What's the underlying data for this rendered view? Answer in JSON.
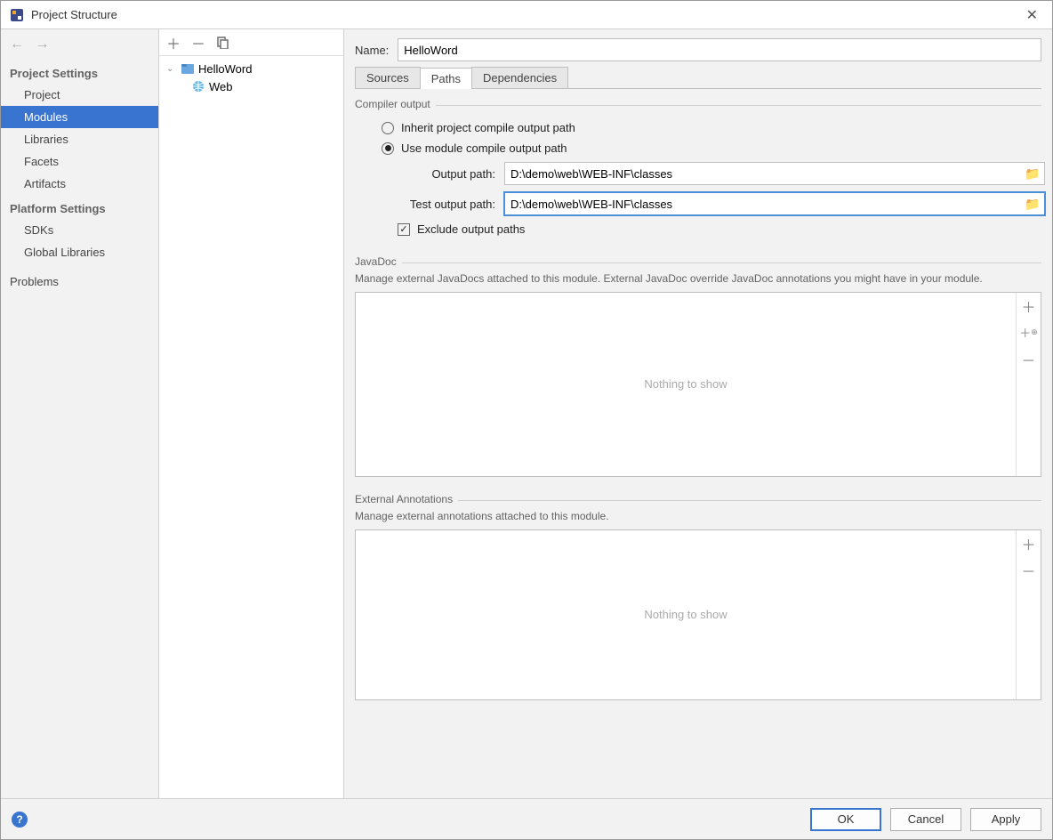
{
  "window": {
    "title": "Project Structure"
  },
  "sidebar": {
    "sections": [
      {
        "title": "Project Settings",
        "items": [
          "Project",
          "Modules",
          "Libraries",
          "Facets",
          "Artifacts"
        ],
        "selected": 1
      },
      {
        "title": "Platform Settings",
        "items": [
          "SDKs",
          "Global Libraries"
        ]
      }
    ],
    "problems": "Problems"
  },
  "tree": {
    "root": {
      "label": "HelloWord"
    },
    "child": {
      "label": "Web"
    }
  },
  "editor": {
    "name_label": "Name:",
    "name_value": "HelloWord",
    "tabs": [
      "Sources",
      "Paths",
      "Dependencies"
    ],
    "active_tab": 1,
    "compiler": {
      "legend": "Compiler output",
      "inherit": "Inherit project compile output path",
      "usemodule": "Use module compile output path",
      "output_label": "Output path:",
      "output_value": "D:\\demo\\web\\WEB-INF\\classes",
      "test_label": "Test output path:",
      "test_value": "D:\\demo\\web\\WEB-INF\\classes",
      "exclude": "Exclude output paths"
    },
    "javadoc": {
      "legend": "JavaDoc",
      "desc": "Manage external JavaDocs attached to this module. External JavaDoc override JavaDoc annotations you might have in your module.",
      "empty": "Nothing to show"
    },
    "annotations": {
      "legend": "External Annotations",
      "desc": "Manage external annotations attached to this module.",
      "empty": "Nothing to show"
    }
  },
  "footer": {
    "ok": "OK",
    "cancel": "Cancel",
    "apply": "Apply"
  }
}
